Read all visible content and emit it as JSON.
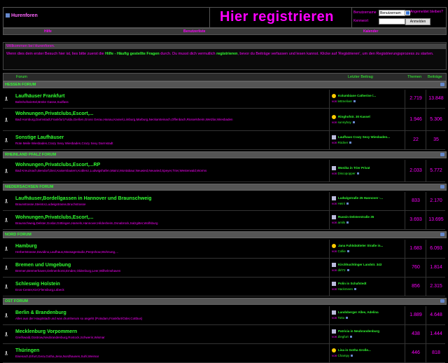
{
  "header": {
    "logo_text": "Hurenforen",
    "title": "Hier registrieren",
    "login": {
      "username_label": "Benutzername",
      "username_value": "Benutzernam",
      "password_label": "Kennwort",
      "remember_label": "Angemeldet bleiben?",
      "submit_label": "Anmelden"
    }
  },
  "nav": [
    "Hilfe",
    "Benutzerliste",
    "Kalender"
  ],
  "welcome": {
    "title": "Willkommen bei Hurenforen.",
    "text_1": "Wenn dies dein erster Besuch hier ist, lies bitte zuerst die ",
    "link_help": "Hilfe - Häufig gestellte Fragen",
    "text_2": " durch. Du musst dich vermutlich ",
    "link_register": "registrieren",
    "text_3": ", bevor du Beiträge verfassen und lesen kannst. Klicke auf 'Registrieren', um den Registrierungsprozess zu starten."
  },
  "table_head": {
    "forum": "Forum",
    "last": "Letzter Beitrag",
    "threads": "Themen",
    "posts": "Beiträge"
  },
  "categories": [
    {
      "name": "HESSEN FORUM",
      "forums": [
        {
          "name": "Laufhäuser Frankfurt",
          "sub": "Bahnhofsviertel,Breite Gasse,Sudfass",
          "lp_title": "Kolumbiane Catherine /...",
          "lp_by": "von",
          "lp_user": "lettmeliver",
          "threads": "2.719",
          "posts": "13.848"
        },
        {
          "name": "Wohnungen,Privatclubs,Escort,...",
          "sub": "Bad Homburg,Darmstadt,Frankfurt,Fulda,Gießen,Gross Gerau,Hanau,Kassel,Limburg,Marburg,Neckarsteinach,Offenbach,Rüsselsheim,Wetzlar,Wiesbaden",
          "lp_title": "Ringhofstr. 30 Kassel",
          "lp_by": "von",
          "lp_user": "sunnyboy",
          "threads": "1.946",
          "posts": "5.306"
        },
        {
          "name": "Sonstige Laufhäuser",
          "sub": "Rote Meile Wiesbaden,Crazy Sexy Wiesbaden,Crazy Sexy Darmstadt",
          "lp_title": "Laufhaus Crazy Sexy Wiesbaden...",
          "lp_by": "von",
          "lp_user": "Rödner",
          "threads": "22",
          "posts": "35"
        }
      ]
    },
    {
      "name": "RHEINLAND PFALZ FORUM",
      "forums": [
        {
          "name": "Wohnungen,Privatclubs,Escort,...RP",
          "sub": "Bad Kreuznach,Bendorf,Diez,Kaiserslautern,Koblenz,Ludwigshafen,Mainz,Montabaur,Neuwied,Neuwied,Speyer,Trier,Westerwald,Worms",
          "lp_title": "Monika in Trier Privat",
          "lp_by": "von",
          "lp_user": "Discopopper",
          "threads": "2.033",
          "posts": "5.772"
        }
      ]
    },
    {
      "name": "NIEDERSACHSEN FORUM",
      "forums": [
        {
          "name": "Laufhäuser,Bordellgassen in Hannover und Braunschweig",
          "sub": "Braunstrasse,Steintor,Ludwigstrasse,Bruchstrasse",
          "lp_title": "Ludwigstraße 25 Hannover -...",
          "lp_by": "von",
          "lp_user": "Heinl",
          "threads": "833",
          "posts": "2.170"
        },
        {
          "name": "Wohnungen,Privatclubs,Escort,...",
          "sub": "Braunschweig,Delster,Goslar,Göttingen,Hameln,Hannover,Hildesheim,Osnabrück,Salzgitter,Wolfsburg",
          "lp_title": "Russin Delsterstraße 35",
          "lp_by": "von",
          "lp_user": "arnils",
          "threads": "3.693",
          "posts": "13.695"
        }
      ]
    },
    {
      "name": "NORD FORUM",
      "forums": [
        {
          "name": "Hamburg",
          "sub": "Herbertstrasse,Davidino,Laufhaus,Massagestudio,Peepshow,Wohnung,...",
          "lp_title": "Jana Fuhlsbütteler Straße in...",
          "lp_by": "von",
          "lp_user": "Collie",
          "threads": "1.683",
          "posts": "6.093"
        },
        {
          "name": "Bremen und Umgebung",
          "sub": "Bremen,Bremerhaven,Delmenhorst,Emden,Oldenburg,Leer,Wilhelmshaven",
          "lp_title": "Kirchhuchtinger Landstr. 343",
          "lp_by": "von",
          "lp_user": "dirl72",
          "threads": "760",
          "posts": "1.814"
        },
        {
          "name": "Schleswig Holstein",
          "sub": "Eros-Center,Kiel,Flensburg,Lübeck",
          "lp_title": "Polin in Schafstedt",
          "lp_by": "von",
          "lp_user": "Hackmeen",
          "threads": "856",
          "posts": "2.315"
        }
      ]
    },
    {
      "name": "OST FORUM",
      "forums": [
        {
          "name": "Berlin & Brandenburg",
          "sub": "Alles aus der Hauptstadt und was drumherum so angeht (Potsdam,Frankfurt/Oder,Cottbus)",
          "lp_title": "Landsberger Allee, Adelina",
          "lp_by": "von",
          "lp_user": "Totto",
          "threads": "1.889",
          "posts": "4.648"
        },
        {
          "name": "Mecklenburg Vorpommern",
          "sub": "Greifswald,Güstrow,Neubrandenburg,Rostock,Schwerin,Wismar",
          "lp_title": "Patricia in Neubrandenburg",
          "lp_by": "von",
          "lp_user": "Ziegfurt",
          "threads": "438",
          "posts": "1.444"
        },
        {
          "name": "Thüringen",
          "sub": "Eisenach,Erfurt,Gera,Gotha,Jena,Nordhausen,Suhl,Weimar",
          "lp_title": "Lisa in Gotha Große...",
          "lp_by": "von",
          "lp_user": "Champy",
          "threads": "446",
          "posts": "818"
        }
      ]
    }
  ]
}
